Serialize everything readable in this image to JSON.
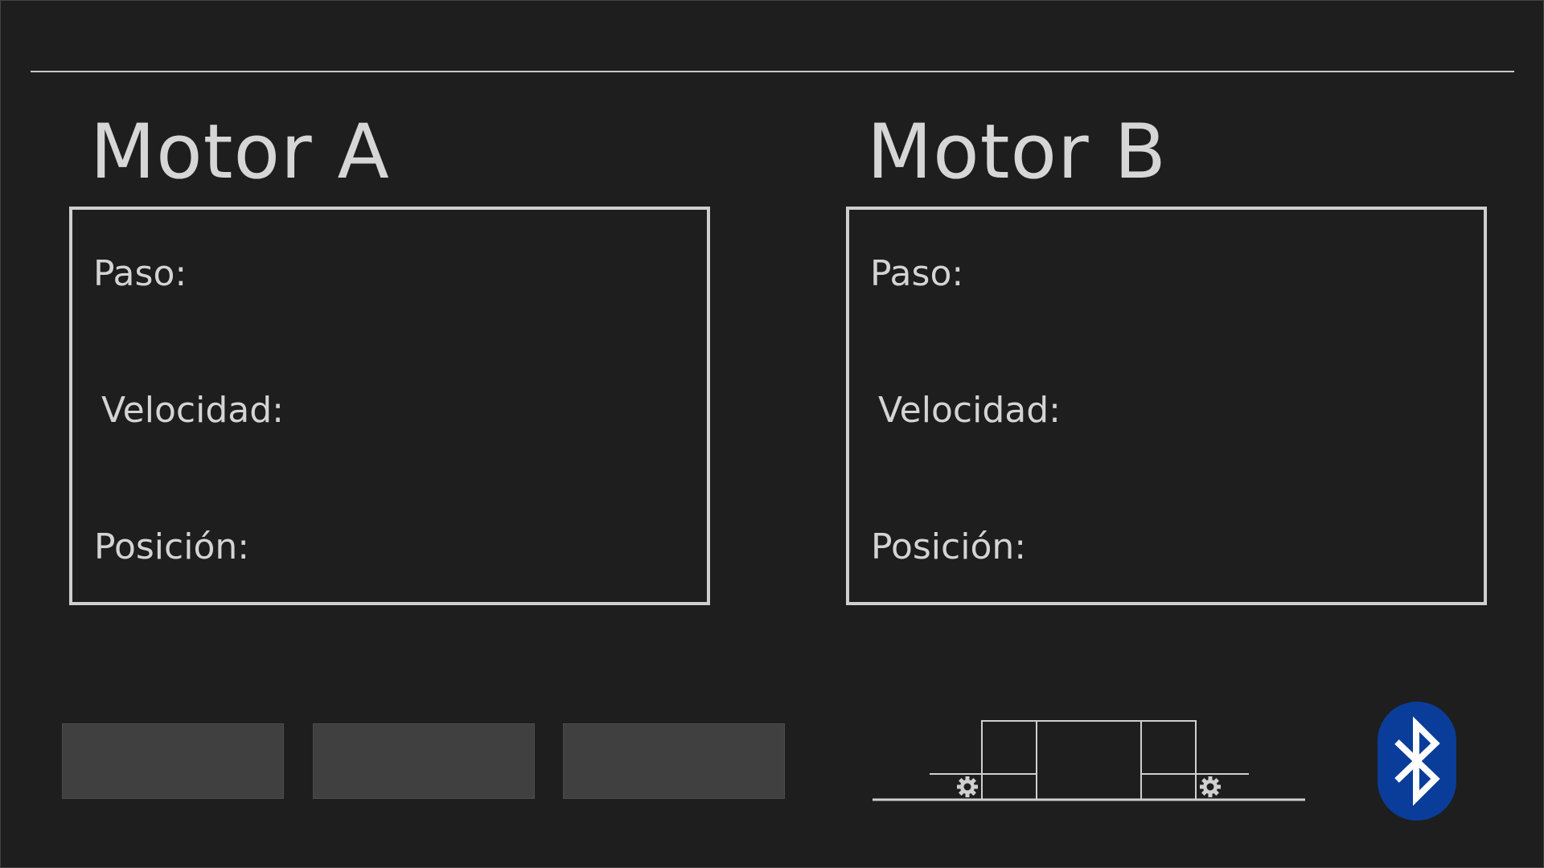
{
  "motor_a": {
    "title": "Motor A",
    "paso_label": "Paso:",
    "velocidad_label": "Velocidad:",
    "posicion_label": "Posición:",
    "paso_value": "",
    "velocidad_value": "",
    "posicion_value": ""
  },
  "motor_b": {
    "title": "Motor B",
    "paso_label": "Paso:",
    "velocidad_label": "Velocidad:",
    "posicion_label": "Posición:",
    "paso_value": "",
    "velocidad_value": "",
    "posicion_value": ""
  },
  "buttons": [
    {
      "label": ""
    },
    {
      "label": ""
    },
    {
      "label": ""
    }
  ],
  "icons": {
    "diagram": "gantry-diagram-icon",
    "gear": "gear-icon",
    "bluetooth": "bluetooth-icon"
  },
  "colors": {
    "background": "#1e1e1e",
    "text": "#d4d4d4",
    "panel_border": "#cfcfcf",
    "button_bg": "#404040",
    "bluetooth_bg": "#0a3d9a"
  }
}
